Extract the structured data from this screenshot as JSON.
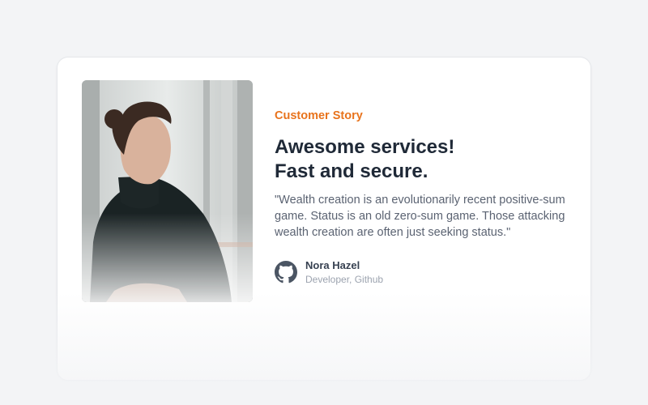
{
  "testimonial": {
    "eyebrow": "Customer Story",
    "title_line1": "Awesome services!",
    "title_line2": "Fast and secure.",
    "quote": "\"Wealth creation is an evolutionarily recent positive-sum game. Status is an old zero-sum game. Those attacking wealth creation are often just seeking status.\"",
    "author": {
      "name": "Nora Hazel",
      "role": "Developer, Github",
      "icon": "github-icon"
    },
    "photo": "woman-portrait-photo"
  },
  "colors": {
    "accent": "#e8731c",
    "heading": "#1f2937",
    "body": "#5b6372",
    "muted": "#9ca3af",
    "background": "#f3f4f6"
  }
}
